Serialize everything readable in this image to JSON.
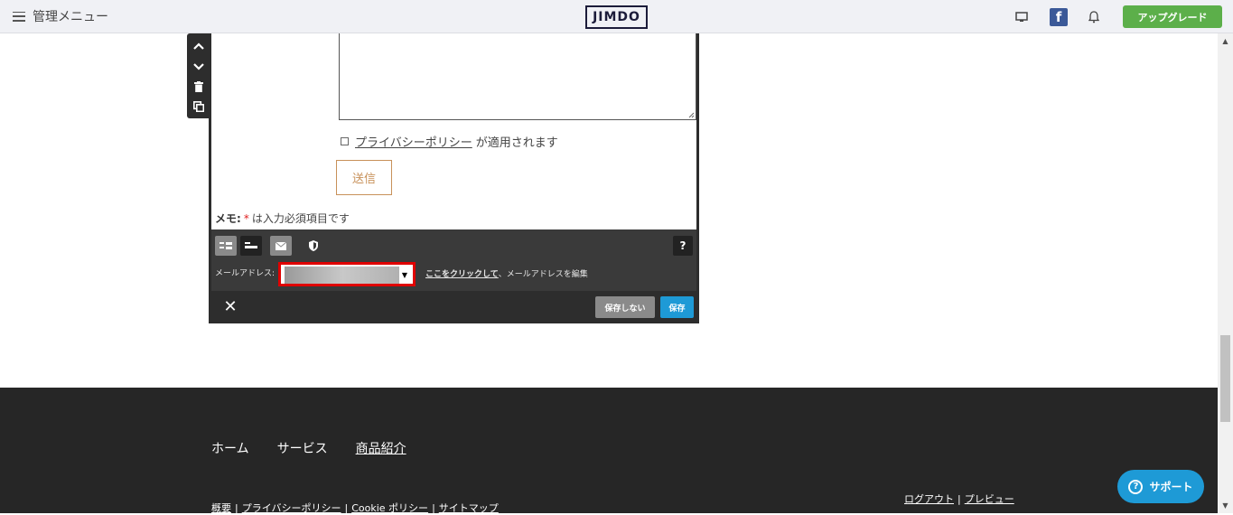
{
  "topbar": {
    "menu_label": "管理メニュー",
    "logo_text": "JIMDO",
    "facebook_glyph": "f",
    "upgrade_label": "アップグレード"
  },
  "form": {
    "privacy_link": "プライバシーポリシー",
    "privacy_suffix": "が適用されます",
    "submit_label": "送信",
    "memo_label": "メモ:",
    "memo_star": "*",
    "memo_text": "は入力必須項目です"
  },
  "toolbar": {
    "help_label": "?",
    "email_label": "メールアドレス:",
    "edit_link": "ここをクリックして",
    "edit_suffix": "、メールアドレスを編集"
  },
  "actions": {
    "close_label": "✕",
    "nosave_label": "保存しない",
    "save_label": "保存"
  },
  "footer": {
    "nav": [
      "ホーム",
      "サービス",
      "商品紹介"
    ],
    "links": [
      "概要",
      "プライバシーポリシー",
      "Cookie ポリシー",
      "サイトマップ"
    ],
    "link_separator": "|",
    "logout": "ログアウト",
    "preview": "プレビュー"
  },
  "support": {
    "icon_glyph": "?",
    "label": "サポート"
  }
}
